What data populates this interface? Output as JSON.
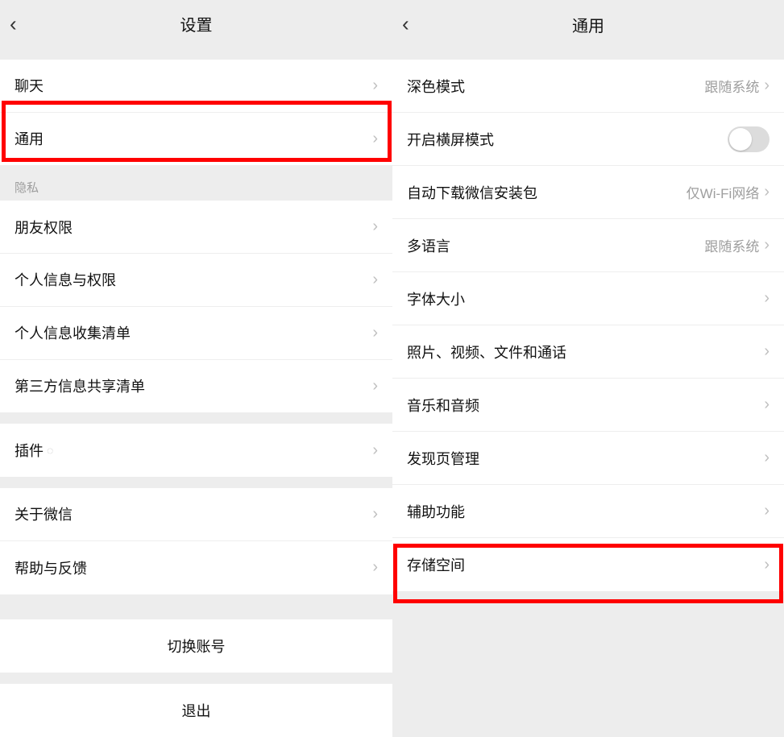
{
  "left": {
    "title": "设置",
    "row_chat": "聊天",
    "row_general": "通用",
    "section_privacy": "隐私",
    "row_friends": "朋友权限",
    "row_personal_info": "个人信息与权限",
    "row_info_collect": "个人信息收集清单",
    "row_third_party": "第三方信息共享清单",
    "row_plugins": "插件",
    "row_about": "关于微信",
    "row_help": "帮助与反馈",
    "switch_account": "切换账号",
    "logout": "退出"
  },
  "right": {
    "title": "通用",
    "row_dark": {
      "label": "深色模式",
      "value": "跟随系统"
    },
    "row_landscape": {
      "label": "开启横屏模式"
    },
    "row_autodl": {
      "label": "自动下载微信安装包",
      "value": "仅Wi-Fi网络"
    },
    "row_lang": {
      "label": "多语言",
      "value": "跟随系统"
    },
    "row_font": "字体大小",
    "row_media": "照片、视频、文件和通话",
    "row_audio": "音乐和音频",
    "row_discover": "发现页管理",
    "row_accessibility": "辅助功能",
    "row_storage": "存储空间"
  }
}
